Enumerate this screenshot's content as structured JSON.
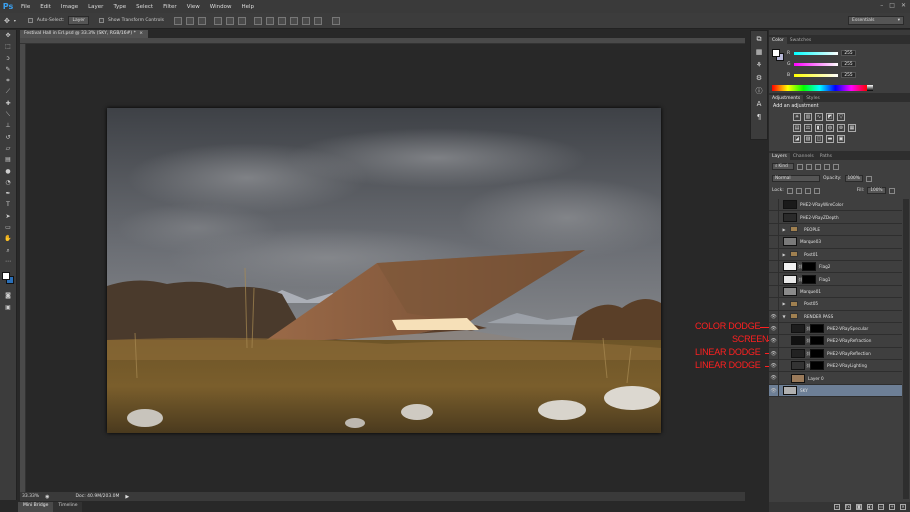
{
  "app": {
    "logo": "Ps"
  },
  "menu": [
    "File",
    "Edit",
    "Image",
    "Layer",
    "Type",
    "Select",
    "Filter",
    "View",
    "Window",
    "Help"
  ],
  "window_controls": [
    "–",
    "□",
    "✕"
  ],
  "options_bar": {
    "auto_select_label": "Auto-Select:",
    "auto_select_value": "Layer",
    "show_transform_label": "Show Transform Controls",
    "workspace": "Essentials"
  },
  "document": {
    "tab_title": "Festival Hall in Erl.psd @ 33.3% (SKY, RGB/16#) *",
    "tab_close": "×",
    "zoom": "33.33%",
    "doc_size": "Doc: 40.9M/203.0M"
  },
  "bottom_tabs": [
    "Mini Bridge",
    "Timeline"
  ],
  "annotations": [
    "COLOR DODGE",
    "SCREEN",
    "LINEAR DODGE",
    "LINEAR DODGE"
  ],
  "color_panel": {
    "tabs": [
      "Color",
      "Swatches"
    ],
    "channels": [
      {
        "label": "R",
        "value": "255",
        "gradient_start": "#00ffff",
        "gradient_end": "#ffffff"
      },
      {
        "label": "G",
        "value": "255",
        "gradient_start": "#ff00ff",
        "gradient_end": "#ffffff"
      },
      {
        "label": "B",
        "value": "255",
        "gradient_start": "#ffff00",
        "gradient_end": "#ffffff"
      }
    ]
  },
  "adjustments_panel": {
    "tabs": [
      "Adjustments",
      "Styles"
    ],
    "heading": "Add an adjustment"
  },
  "layers_panel": {
    "tabs": [
      "Layers",
      "Channels",
      "Paths"
    ],
    "filter_kind": "Kind",
    "blend_mode": "Normal",
    "opacity_label": "Opacity:",
    "opacity_value": "100%",
    "lock_label": "Lock:",
    "fill_label": "Fill:",
    "fill_value": "100%",
    "layers": [
      {
        "name": "PHE2-VRayWireColor",
        "type": "layer",
        "visible": false,
        "thumb": "#1a1a1a",
        "mask": false
      },
      {
        "name": "PHE2-VRayZDepth",
        "type": "layer",
        "visible": false,
        "thumb": "#2a2a2a",
        "mask": false
      },
      {
        "name": "PEOPLE",
        "type": "group",
        "visible": false
      },
      {
        "name": "Marque03",
        "type": "layer",
        "visible": false,
        "thumb": "#7a7a7a",
        "mask": false
      },
      {
        "name": "Post01",
        "type": "group",
        "visible": false
      },
      {
        "name": "Flag2",
        "type": "layer",
        "visible": false,
        "thumb": "#f2f2f2",
        "mask": true
      },
      {
        "name": "Flag1",
        "type": "layer",
        "visible": false,
        "thumb": "#e8e8e8",
        "mask": true
      },
      {
        "name": "Marque01",
        "type": "layer",
        "visible": false,
        "thumb": "#8a8a8a",
        "mask": false
      },
      {
        "name": "Post05",
        "type": "group",
        "visible": false
      },
      {
        "name": "RENDER PASS",
        "type": "group-open",
        "visible": true
      },
      {
        "name": "PHE2-VRaySpecular",
        "type": "layer",
        "visible": true,
        "thumb": "#1d1d1d",
        "mask": true,
        "indent": true
      },
      {
        "name": "PHE2-VRayRefraction",
        "type": "layer",
        "visible": true,
        "thumb": "#111111",
        "mask": true,
        "indent": true
      },
      {
        "name": "PHE2-VRayReflection",
        "type": "layer",
        "visible": true,
        "thumb": "#222222",
        "mask": true,
        "indent": true
      },
      {
        "name": "PHE2-VRayLighting",
        "type": "layer",
        "visible": true,
        "thumb": "#333333",
        "mask": true,
        "indent": true
      },
      {
        "name": "Layer 0",
        "type": "layer",
        "visible": true,
        "thumb": "#9a7a5a",
        "mask": false,
        "indent": true
      },
      {
        "name": "SKY",
        "type": "layer",
        "visible": true,
        "thumb": "#b0b0b0",
        "mask": false,
        "selected": true
      }
    ]
  },
  "colors": {
    "selection": "#6d7f96",
    "annotation": "#ff2020",
    "ps_blue": "#3aa0f0"
  }
}
